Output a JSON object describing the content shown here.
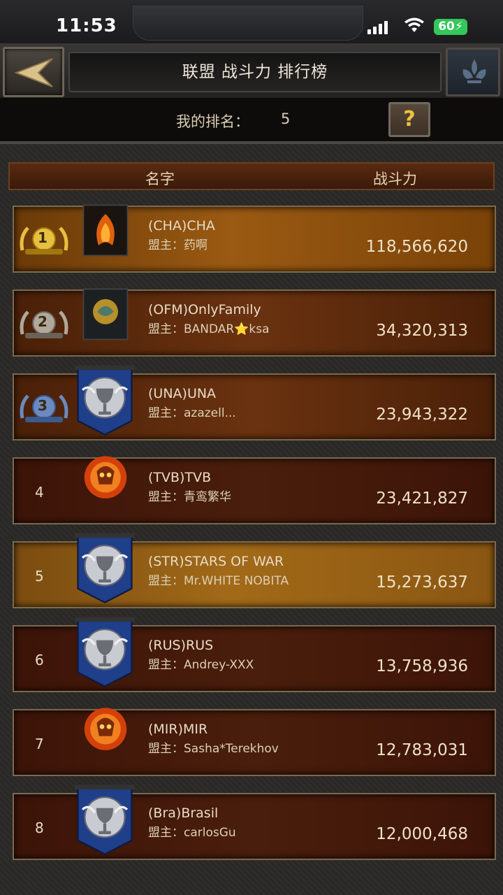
{
  "status_bar": {
    "time": "11:53",
    "battery": "60"
  },
  "header": {
    "title": "联盟 战斗力 排行榜"
  },
  "my_rank": {
    "label": "我的排名：",
    "value": "5"
  },
  "help_button": {
    "label": "?"
  },
  "columns": {
    "name": "名字",
    "power": "战斗力"
  },
  "rows": [
    {
      "rank": "1",
      "name": "(CHA)CHA",
      "leader_label": "盟主：",
      "leader": "药啊",
      "power": "118,566,620",
      "emblem": "fire-wings-banner",
      "style": "gold"
    },
    {
      "rank": "2",
      "name": "(OFM)OnlyFamily",
      "leader_label": "盟主：",
      "leader": "BANDAR⭐ksa",
      "power": "34,320,313",
      "emblem": "dragon-banner",
      "style": "top"
    },
    {
      "rank": "3",
      "name": "(UNA)UNA",
      "leader_label": "盟主：",
      "leader": "azazell...",
      "power": "23,943,322",
      "emblem": "grail-blue-banner",
      "style": "top"
    },
    {
      "rank": "4",
      "name": "(TVB)TVB",
      "leader_label": "盟主：",
      "leader": "青鸾繁华",
      "power": "23,421,827",
      "emblem": "flame-skull-crest",
      "style": "normal"
    },
    {
      "rank": "5",
      "name": "(STR)STARS OF WAR",
      "leader_label": "盟主：",
      "leader": "Mr.WHITE NOBITA",
      "power": "15,273,637",
      "emblem": "grail-blue-banner",
      "style": "mine"
    },
    {
      "rank": "6",
      "name": "(RUS)RUS",
      "leader_label": "盟主：",
      "leader": "Andrey-XXX",
      "power": "13,758,936",
      "emblem": "grail-blue-banner",
      "style": "normal"
    },
    {
      "rank": "7",
      "name": "(MIR)MIR",
      "leader_label": "盟主：",
      "leader": "Sasha*Terekhov",
      "power": "12,783,031",
      "emblem": "flame-skull-crest",
      "style": "normal"
    },
    {
      "rank": "8",
      "name": "(Bra)Brasil",
      "leader_label": "盟主：",
      "leader": "carlosGu",
      "power": "12,000,468",
      "emblem": "grail-blue-banner",
      "style": "normal"
    }
  ],
  "colors": {
    "row_bg": "#4a1e0c",
    "row_border": "#7a6a50",
    "mine_bg": "#a26a18",
    "text": "#e8dcc6"
  }
}
